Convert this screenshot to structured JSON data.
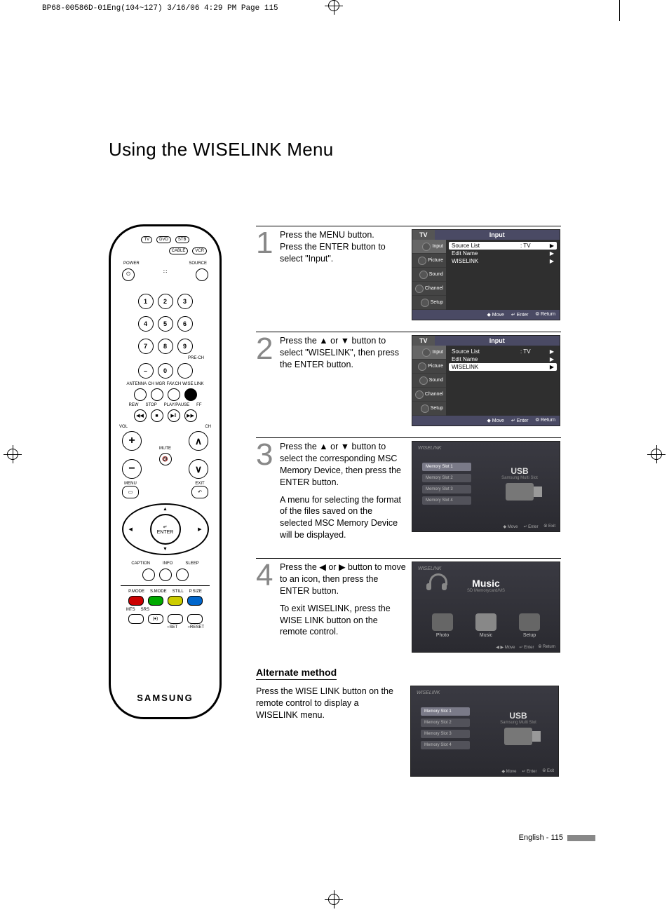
{
  "header_info": "BP68-00586D-01Eng(104~127)  3/16/06  4:29 PM  Page 115",
  "page_title": "Using the WISELINK Menu",
  "remote": {
    "device_tabs": [
      "TV",
      "DVD",
      "STB",
      "CABLE",
      "VCR"
    ],
    "labels": {
      "power": "POWER",
      "source": "SOURCE",
      "prech": "PRE-CH",
      "antenna": "ANTENNA",
      "chmgr": "CH MGR",
      "favch": "FAV.CH",
      "wiselink": "WISE LINK",
      "rew": "REW",
      "stop": "STOP",
      "playpause": "PLAY/PAUSE",
      "ff": "FF",
      "vol": "VOL",
      "ch": "CH",
      "mute": "MUTE",
      "menu": "MENU",
      "exit": "EXIT",
      "enter": "ENTER",
      "caption": "CAPTION",
      "info": "INFO",
      "sleep": "SLEEP",
      "pmode": "P.MODE",
      "smode": "S.MODE",
      "still": "STILL",
      "psize": "P.SIZE",
      "mts": "MTS",
      "srs": "SRS",
      "set": "SET",
      "reset": "RESET",
      "brand": "SAMSUNG"
    },
    "numpad": [
      "1",
      "2",
      "3",
      "4",
      "5",
      "6",
      "7",
      "8",
      "9",
      "–",
      "0"
    ]
  },
  "steps": [
    {
      "num": "1",
      "text": "Press the MENU button.\nPress the ENTER button to select \"Input\"."
    },
    {
      "num": "2",
      "text": "Press the ▲ or ▼ button to select \"WISELINK\", then press the ENTER button."
    },
    {
      "num": "3",
      "text_a": "Press the ▲ or ▼ button to select the corresponding MSC Memory Device, then press the ENTER button.",
      "text_b": "A menu for selecting the format of the files saved on the selected MSC Memory Device will be displayed."
    },
    {
      "num": "4",
      "text_a": "Press the ◀ or ▶ button to move to an icon, then press the ENTER button.",
      "text_b": "To exit WISELINK, press the WISE LINK button on the remote control."
    }
  ],
  "tv_menu": {
    "tab": "TV",
    "title": "Input",
    "side": [
      "Input",
      "Picture",
      "Sound",
      "Channel",
      "Setup"
    ],
    "rows": [
      {
        "label": "Source List",
        "value": ": TV"
      },
      {
        "label": "Edit Name",
        "value": ""
      },
      {
        "label": "WISELINK",
        "value": ""
      }
    ],
    "foot": [
      "◆ Move",
      "↵ Enter",
      "⦾ Return"
    ]
  },
  "wl": {
    "logo": "WISELINK",
    "slots": [
      "Memory Slot 1",
      "Memory Slot 2",
      "Memory Slot 3",
      "Memory Slot 4"
    ],
    "usb": "USB",
    "usb_sub": "Samsung Multi Slot",
    "foot": [
      "◆ Move",
      "↵ Enter",
      "⦾ Exit"
    ]
  },
  "music": {
    "title": "Music",
    "sub": "SD Memorycard/MS",
    "items": [
      "Photo",
      "Music",
      "Setup"
    ],
    "foot": [
      "◀ ▶ Move",
      "↵ Enter",
      "⦾ Return"
    ]
  },
  "alternate": {
    "heading": "Alternate method",
    "text": "Press the WISE LINK button on the remote control to display a WISELINK menu."
  },
  "footer": "English - 115"
}
